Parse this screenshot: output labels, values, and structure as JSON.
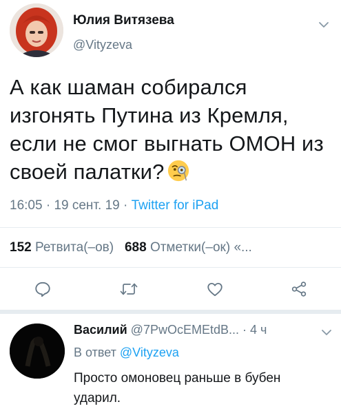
{
  "tweet": {
    "author_name": "Юлия Витязева",
    "author_handle": "@Vityzeva",
    "text": "А как шаман собирался изгонять Путина из Кремля, если не смог выгнать ОМОН из своей палатки?",
    "emoji": "face-with-monocle",
    "time": "16:05",
    "date": "19 сент. 19",
    "source": "Twitter for iPad",
    "retweets_count": "152",
    "retweets_label": "Ретвита(–ов)",
    "likes_count": "688",
    "likes_label": "Отметки(–ок)",
    "overflow": "«..."
  },
  "actions": [
    {
      "name": "reply",
      "icon": "comment-icon"
    },
    {
      "name": "retweet",
      "icon": "retweet-icon"
    },
    {
      "name": "like",
      "icon": "heart-icon"
    },
    {
      "name": "share",
      "icon": "share-icon"
    }
  ],
  "reply": {
    "author_name": "Василий",
    "author_handle": "@7PwOcEMEtdB...",
    "age": "· 4 ч",
    "in_reply_prefix": "В ответ",
    "in_reply_handle": "@Vityzeva",
    "text": "Просто омоновец раньше в бубен ударил."
  },
  "colors": {
    "accent": "#1da1f2",
    "text_primary": "#14171a",
    "text_secondary": "#657786",
    "divider": "#e6ecf0"
  }
}
